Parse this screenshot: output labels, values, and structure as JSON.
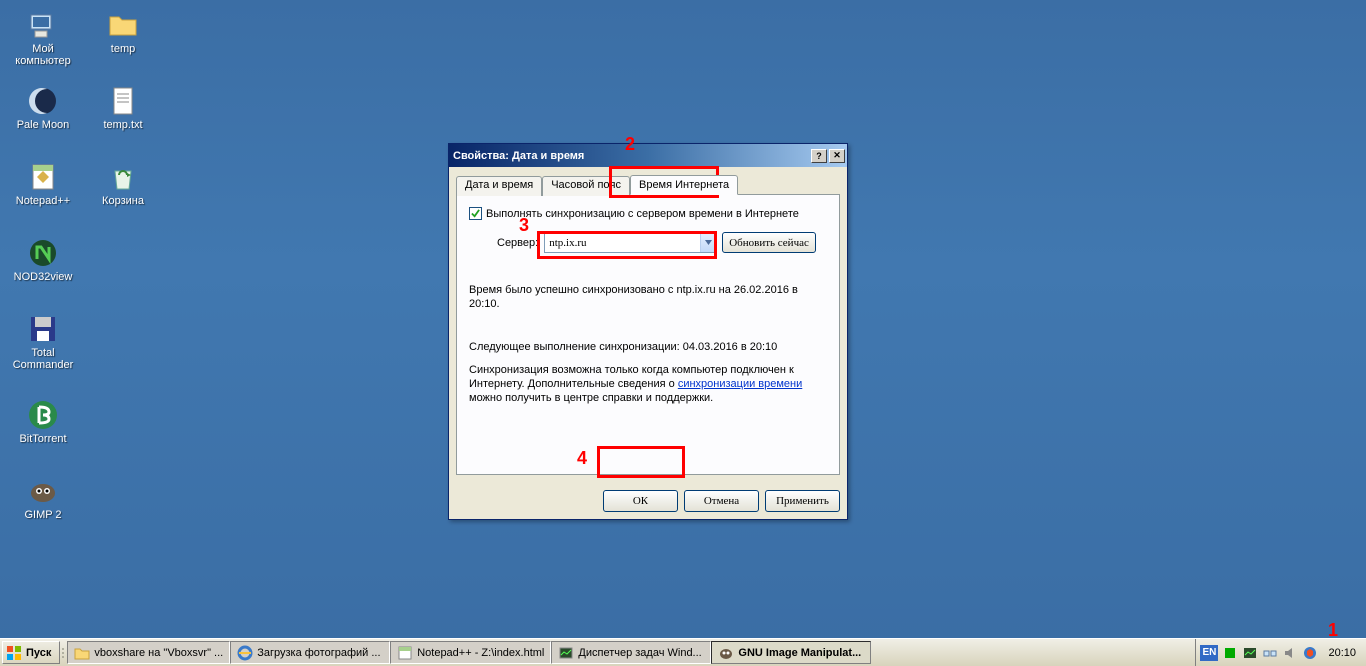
{
  "desktop": {
    "icons": [
      {
        "name": "my-computer",
        "label": "Мой\nкомпьютер",
        "glyph": "computer"
      },
      {
        "name": "temp-folder",
        "label": "temp",
        "glyph": "folder"
      },
      {
        "name": "pale-moon",
        "label": "Pale Moon",
        "glyph": "palemoon"
      },
      {
        "name": "temp-txt",
        "label": "temp.txt",
        "glyph": "textfile"
      },
      {
        "name": "notepadpp",
        "label": "Notepad++",
        "glyph": "notepadpp"
      },
      {
        "name": "recycle-bin",
        "label": "Корзина",
        "glyph": "recycle"
      },
      {
        "name": "nod32view",
        "label": "NOD32view",
        "glyph": "nod32"
      },
      {
        "name": "total-commander",
        "label": "Total\nCommander",
        "glyph": "floppy"
      },
      {
        "name": "bittorrent",
        "label": "BitTorrent",
        "glyph": "bittorrent"
      },
      {
        "name": "gimp2",
        "label": "GIMP 2",
        "glyph": "gimp"
      }
    ]
  },
  "dialog": {
    "title": "Свойства: Дата и время",
    "tabs": {
      "date_time": "Дата и время",
      "timezone": "Часовой пояс",
      "internet_time": "Время Интернета"
    },
    "sync_checkbox_label": "Выполнять синхронизацию с сервером времени в Интернете",
    "server_label": "Сервер:",
    "server_value": "ntp.ix.ru",
    "refresh_button": "Обновить сейчас",
    "status_text": "Время было успешно синхронизовано с ntp.ix.ru на 26.02.2016 в 20:10.",
    "next_sync_text": "Следующее выполнение синхронизации: 04.03.2016 в 20:10",
    "note_prefix": "Синхронизация возможна только когда компьютер подключен к Интернету. Дополнительные сведения о ",
    "note_link": "синхронизации времени",
    "note_suffix": " можно получить в центре справки и поддержки.",
    "ok": "ОК",
    "cancel": "Отмена",
    "apply": "Применить"
  },
  "annotations": {
    "n1": "1",
    "n2": "2",
    "n3": "3",
    "n4": "4"
  },
  "taskbar": {
    "start": "Пуск",
    "tasks": [
      {
        "name": "vboxshare",
        "label": "vboxshare на \"Vboxsvr\" ...",
        "icon": "folder"
      },
      {
        "name": "browser",
        "label": "Загрузка фотографий ...",
        "icon": "ie"
      },
      {
        "name": "notepadpp",
        "label": "Notepad++ - Z:\\index.html",
        "icon": "notepadpp"
      },
      {
        "name": "taskmgr",
        "label": "Диспетчер задач Wind...",
        "icon": "taskmgr"
      },
      {
        "name": "gimp",
        "label": "GNU Image Manipulat...",
        "icon": "gimp",
        "pressed": true
      }
    ],
    "lang": "EN",
    "clock": "20:10"
  }
}
